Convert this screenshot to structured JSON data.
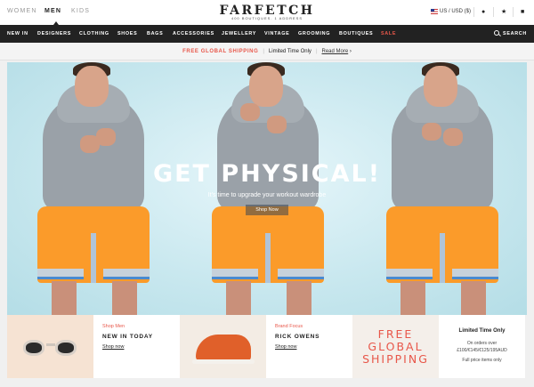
{
  "header": {
    "genders": [
      "WOMEN",
      "MEN",
      "KIDS"
    ],
    "active_gender": "MEN",
    "logo": "FARFETCH",
    "logo_tagline": "400 BOUTIQUES. 1 ADDRESS",
    "currency": "US / USD ($)",
    "icons": [
      "flag-us-icon",
      "user-icon",
      "star-icon",
      "bag-icon"
    ]
  },
  "nav": {
    "items": [
      "NEW IN",
      "DESIGNERS",
      "CLOTHING",
      "SHOES",
      "BAGS",
      "ACCESSORIES",
      "JEWELLERY",
      "VINTAGE",
      "GROOMING",
      "BOUTIQUES",
      "SALE"
    ],
    "search_label": "SEARCH"
  },
  "promo": {
    "headline": "FREE GLOBAL SHIPPING",
    "note": "Limited Time Only",
    "link": "Read More"
  },
  "hero": {
    "title": "GET PHYSICAL!",
    "subtitle": "It's time to upgrade your workout wardrobe",
    "button": "Shop Now"
  },
  "tiles": {
    "shop_men": {
      "category": "Shop Men",
      "title": "NEW IN TODAY",
      "link": "Shop now"
    },
    "brand_focus": {
      "category": "Brand Focus",
      "title": "RICK OWENS",
      "link": "Shop now"
    },
    "shipping": {
      "line1": "FREE",
      "line2": "GLOBAL",
      "line3": "SHIPPING"
    },
    "limited": {
      "title": "Limited Time Only",
      "line1": "On orders over",
      "line2": "£100/€145/€125/195AUD",
      "line3": "Full price items only"
    }
  },
  "colors": {
    "accent": "#e8574a",
    "nav_bg": "#222222",
    "hero_bg": "#c9e8ef",
    "shorts": "#fb9b2a"
  }
}
